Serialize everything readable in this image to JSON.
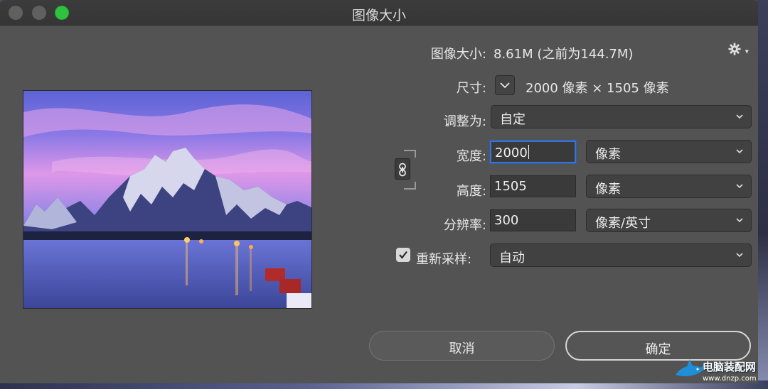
{
  "window": {
    "title": "图像大小"
  },
  "info": {
    "image_size_label": "图像大小:",
    "image_size_value": "8.61M (之前为144.7M)",
    "dimensions_label": "尺寸:",
    "dimensions_value": "2000 像素 × 1505 像素"
  },
  "fit_to": {
    "label": "调整为:",
    "value": "自定"
  },
  "width": {
    "label": "宽度:",
    "value": "2000",
    "unit": "像素"
  },
  "height": {
    "label": "高度:",
    "value": "1505",
    "unit": "像素"
  },
  "resolution": {
    "label": "分辨率:",
    "value": "300",
    "unit": "像素/英寸"
  },
  "resample": {
    "label": "重新采样:",
    "checked": true,
    "value": "自动"
  },
  "buttons": {
    "cancel": "取消",
    "ok": "确定"
  },
  "watermark": {
    "line1": "电脑装配网",
    "line2": "www.dnzp.com"
  },
  "colors": {
    "dialog_bg": "#535353",
    "focus_ring": "#3d73c8",
    "maximize_green": "#2ec240"
  },
  "icons": {
    "settings": "gear-icon",
    "dimensions_toggle": "chevron-down-icon",
    "constrain": "link-icon",
    "resample_check": "checkmark-icon"
  }
}
